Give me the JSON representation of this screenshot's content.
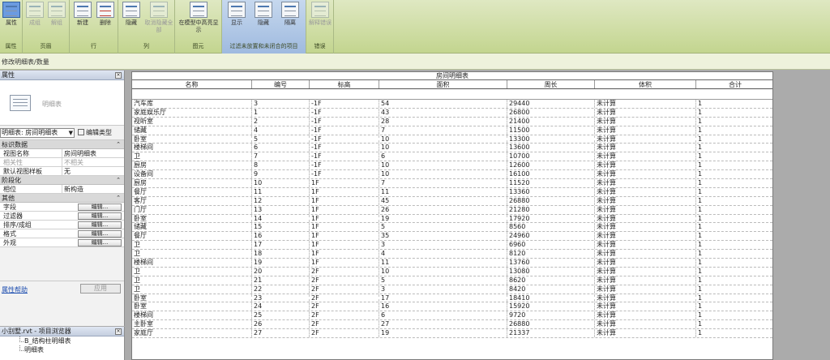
{
  "ribbon": {
    "groups": [
      {
        "label": "属性",
        "buttons": [
          "属性"
        ]
      },
      {
        "label": "页眉",
        "buttons": [
          "成组",
          "解组"
        ]
      },
      {
        "label": "行",
        "buttons": [
          "新建",
          "删除"
        ]
      },
      {
        "label": "列",
        "buttons": [
          "隐藏",
          "取消隐藏全部"
        ]
      },
      {
        "label": "图元",
        "buttons": [
          "在模型中高亮显示"
        ]
      },
      {
        "label": "过滤未放置和未闭合的项目",
        "buttons": [
          "显示",
          "隐藏",
          "隔离"
        ]
      },
      {
        "label": "错误",
        "buttons": [
          "解释错误"
        ]
      }
    ]
  },
  "context_bar": "修改明细表/数量",
  "properties": {
    "title": "属性",
    "close": "×",
    "type_name": "明细表",
    "selector": "明细表: 房间明细表",
    "edit_type": "编辑类型",
    "sections": {
      "identity": "标识数据",
      "phasing": "阶段化",
      "other": "其他"
    },
    "identity_rows": [
      {
        "k": "视图名称",
        "v": "房间明细表"
      },
      {
        "k": "相关性",
        "v": "不相关"
      },
      {
        "k": "默认视图样板",
        "v": "无"
      }
    ],
    "phase_rows": [
      {
        "k": "相位",
        "v": "新构造"
      }
    ],
    "other_rows": [
      {
        "k": "字段",
        "v": "编辑..."
      },
      {
        "k": "过滤器",
        "v": "编辑..."
      },
      {
        "k": "排序/成组",
        "v": "编辑..."
      },
      {
        "k": "格式",
        "v": "编辑..."
      },
      {
        "k": "外观",
        "v": "编辑..."
      }
    ],
    "help_link": "属性帮助",
    "apply": "应用"
  },
  "browser": {
    "title": "小别墅.rvt - 项目浏览器",
    "items": [
      "B_结构柱明细表",
      "明细表"
    ]
  },
  "schedule": {
    "title": "房间明细表",
    "headers": [
      "名称",
      "编号",
      "标高",
      "面积",
      "周长",
      "体积",
      "合计"
    ],
    "rows": [
      [
        "汽车库",
        "3",
        "-1F",
        "54",
        "29440",
        "未计算",
        "1"
      ],
      [
        "家庭娱乐厅",
        "1",
        "-1F",
        "43",
        "26800",
        "未计算",
        "1"
      ],
      [
        "视听室",
        "2",
        "-1F",
        "28",
        "21400",
        "未计算",
        "1"
      ],
      [
        "储藏",
        "4",
        "-1F",
        "7",
        "11500",
        "未计算",
        "1"
      ],
      [
        "卧室",
        "5",
        "-1F",
        "10",
        "13300",
        "未计算",
        "1"
      ],
      [
        "楼梯间",
        "6",
        "-1F",
        "10",
        "13600",
        "未计算",
        "1"
      ],
      [
        "卫",
        "7",
        "-1F",
        "6",
        "10700",
        "未计算",
        "1"
      ],
      [
        "厨房",
        "8",
        "-1F",
        "10",
        "12600",
        "未计算",
        "1"
      ],
      [
        "设备间",
        "9",
        "-1F",
        "10",
        "16100",
        "未计算",
        "1"
      ],
      [
        "厨房",
        "10",
        "1F",
        "7",
        "11520",
        "未计算",
        "1"
      ],
      [
        "餐厅",
        "11",
        "1F",
        "11",
        "13360",
        "未计算",
        "1"
      ],
      [
        "客厅",
        "12",
        "1F",
        "45",
        "26880",
        "未计算",
        "1"
      ],
      [
        "门厅",
        "13",
        "1F",
        "26",
        "21280",
        "未计算",
        "1"
      ],
      [
        "卧室",
        "14",
        "1F",
        "19",
        "17920",
        "未计算",
        "1"
      ],
      [
        "储藏",
        "15",
        "1F",
        "5",
        "8560",
        "未计算",
        "1"
      ],
      [
        "餐厅",
        "16",
        "1F",
        "35",
        "24960",
        "未计算",
        "1"
      ],
      [
        "卫",
        "17",
        "1F",
        "3",
        "6960",
        "未计算",
        "1"
      ],
      [
        "卫",
        "18",
        "1F",
        "4",
        "8120",
        "未计算",
        "1"
      ],
      [
        "楼梯间",
        "19",
        "1F",
        "11",
        "13760",
        "未计算",
        "1"
      ],
      [
        "卫",
        "20",
        "2F",
        "10",
        "13080",
        "未计算",
        "1"
      ],
      [
        "卫",
        "21",
        "2F",
        "5",
        "8620",
        "未计算",
        "1"
      ],
      [
        "卫",
        "22",
        "2F",
        "3",
        "8420",
        "未计算",
        "1"
      ],
      [
        "卧室",
        "23",
        "2F",
        "17",
        "18410",
        "未计算",
        "1"
      ],
      [
        "卧室",
        "24",
        "2F",
        "16",
        "15920",
        "未计算",
        "1"
      ],
      [
        "楼梯间",
        "25",
        "2F",
        "6",
        "9720",
        "未计算",
        "1"
      ],
      [
        "主卧室",
        "26",
        "2F",
        "27",
        "26880",
        "未计算",
        "1"
      ],
      [
        "家庭厅",
        "27",
        "2F",
        "19",
        "21337",
        "未计算",
        "1"
      ]
    ]
  }
}
